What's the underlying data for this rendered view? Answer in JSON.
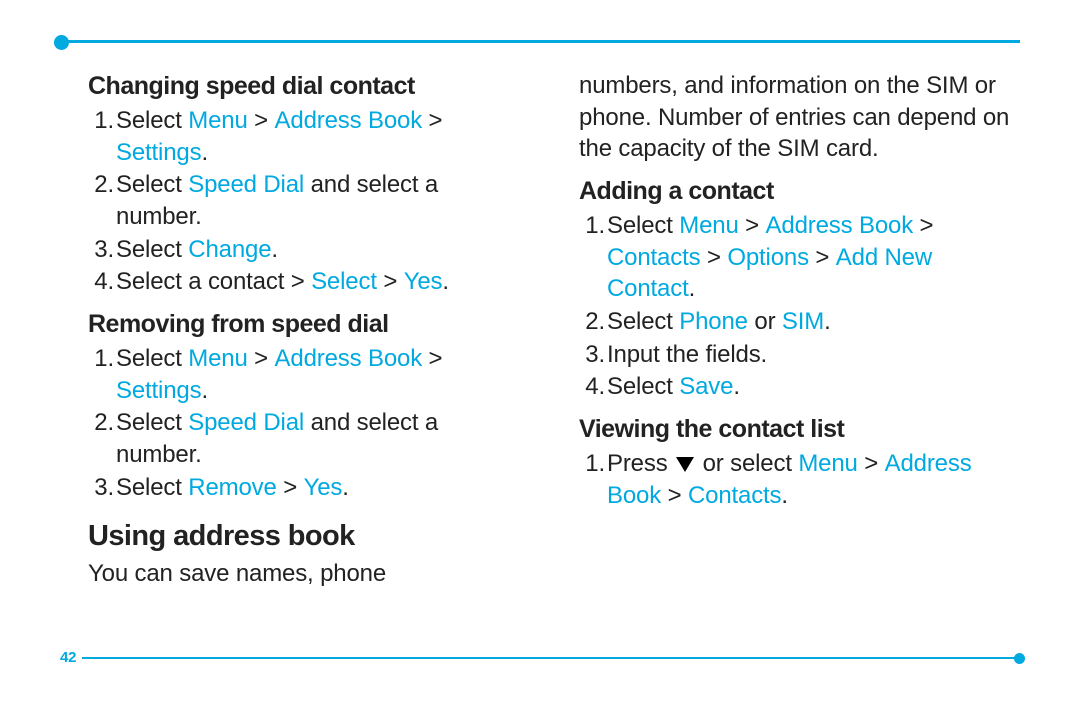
{
  "pageNumber": "42",
  "col1": {
    "s1": {
      "heading": "Changing speed dial contact",
      "i1": {
        "pre": "Select ",
        "l1": "Menu",
        "gt1": " > ",
        "l2": "Address Book",
        "gt2": " > ",
        "l3": "Settings",
        "post": "."
      },
      "i2": {
        "pre": "Select ",
        "l1": "Speed Dial",
        "post": " and select a number."
      },
      "i3": {
        "pre": "Select ",
        "l1": "Change",
        "post": "."
      },
      "i4": {
        "pre": "Select a contact > ",
        "l1": "Select",
        "mid": " > ",
        "l2": "Yes",
        "post": "."
      }
    },
    "s2": {
      "heading": "Removing from speed dial",
      "i1": {
        "pre": "Select ",
        "l1": "Menu",
        "gt1": " > ",
        "l2": "Address Book",
        "gt2": " > ",
        "l3": "Settings",
        "post": "."
      },
      "i2": {
        "pre": "Select ",
        "l1": "Speed Dial",
        "post": " and select a number."
      },
      "i3": {
        "pre": "Select ",
        "l1": "Remove",
        "mid": " > ",
        "l2": "Yes",
        "post": "."
      }
    },
    "s3": {
      "heading": "Using address book",
      "text": "You can save names, phone"
    }
  },
  "col2": {
    "leadText": "numbers, and information on the SIM or phone. Number of entries can depend on the capacity of the SIM card.",
    "s4": {
      "heading": "Adding a contact",
      "i1": {
        "pre": "Select ",
        "l1": "Menu",
        "gt1": " > ",
        "l2": "Address Book",
        "gt2": " > ",
        "l3": "Contacts",
        "gt3": " > ",
        "l4": "Options",
        "gt4": " > ",
        "l5": "Add New Contact",
        "post": "."
      },
      "i2": {
        "pre": "Select ",
        "l1": "Phone",
        "mid": " or ",
        "l2": "SIM",
        "post": "."
      },
      "i3": {
        "text": "Input the fields."
      },
      "i4": {
        "pre": "Select ",
        "l1": "Save",
        "post": "."
      }
    },
    "s5": {
      "heading": "Viewing the contact list",
      "i1": {
        "pre": "Press ",
        "mid": " or select ",
        "l1": "Menu",
        "gt1": " > ",
        "l2": "Address Book",
        "gt2": " > ",
        "l3": "Contacts",
        "post": "."
      }
    }
  }
}
